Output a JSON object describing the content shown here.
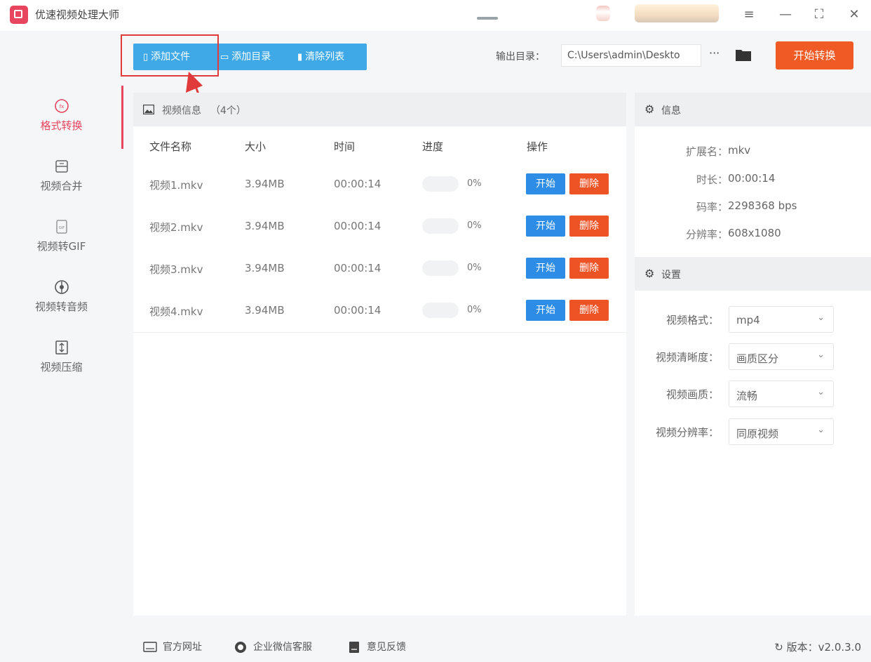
{
  "app": {
    "title": "优速视频处理大师"
  },
  "window_controls": {
    "menu": "≡",
    "minimize": "—",
    "maximize": "⛶",
    "close": "✕"
  },
  "sidebar": {
    "items": [
      {
        "label": "格式转换",
        "icon": "format-convert-icon"
      },
      {
        "label": "视频合并",
        "icon": "video-merge-icon"
      },
      {
        "label": "视频转GIF",
        "icon": "gif-icon"
      },
      {
        "label": "视频转音频",
        "icon": "audio-icon"
      },
      {
        "label": "视频压缩",
        "icon": "compress-icon"
      }
    ]
  },
  "toolbar": {
    "add_file": "添加文件",
    "add_dir": "添加目录",
    "clear_list": "清除列表",
    "output_label": "输出目录：",
    "output_path": "C:\\Users\\admin\\Deskto",
    "more": "···",
    "start_convert": "开始转换"
  },
  "file_panel": {
    "title": "视频信息",
    "count": "（4个）",
    "columns": [
      "文件名称",
      "大小",
      "时间",
      "进度",
      "操作"
    ],
    "rows": [
      {
        "name": "视频1.mkv",
        "size": "3.94MB",
        "time": "00:00:14",
        "progress": "0%",
        "progress_value": 0,
        "start": "开始",
        "delete": "删除"
      },
      {
        "name": "视频2.mkv",
        "size": "3.94MB",
        "time": "00:00:14",
        "progress": "0%",
        "progress_value": 0,
        "start": "开始",
        "delete": "删除"
      },
      {
        "name": "视频3.mkv",
        "size": "3.94MB",
        "time": "00:00:14",
        "progress": "0%",
        "progress_value": 0,
        "start": "开始",
        "delete": "删除"
      },
      {
        "name": "视频4.mkv",
        "size": "3.94MB",
        "time": "00:00:14",
        "progress": "0%",
        "progress_value": 0,
        "start": "开始",
        "delete": "删除"
      }
    ]
  },
  "info": {
    "title": "信息",
    "fields": [
      {
        "label": "扩展名：",
        "value": "mkv"
      },
      {
        "label": "时长：",
        "value": "00:00:14"
      },
      {
        "label": "码率：",
        "value": "2298368 bps"
      },
      {
        "label": "分辨率：",
        "value": "608x1080"
      }
    ]
  },
  "settings": {
    "title": "设置",
    "fields": [
      {
        "label": "视频格式：",
        "value": "mp4"
      },
      {
        "label": "视频清晰度：",
        "value": "画质区分"
      },
      {
        "label": "视频画质：",
        "value": "流畅"
      },
      {
        "label": "视频分辨率：",
        "value": "同原视频"
      }
    ]
  },
  "bottom": {
    "website": "官方网址",
    "wechat": "企业微信客服",
    "feedback": "意见反馈",
    "version": "版本：v2.0.3.0"
  },
  "colors": {
    "accent": "#e8455f",
    "toolbar_blue": "#3fa9e8",
    "start_orange": "#f05a24",
    "start_blue": "#2d8ce6",
    "delete_orange": "#ee5326",
    "annotation_red": "#e03a3a"
  }
}
